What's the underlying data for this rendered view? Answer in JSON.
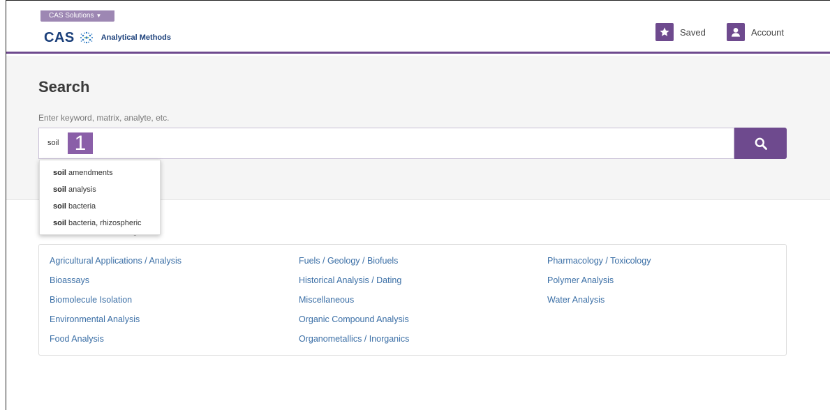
{
  "header": {
    "solutions_label": "CAS Solutions",
    "logo_text": "CAS",
    "product_name": "Analytical Methods",
    "saved_label": "Saved",
    "account_label": "Account"
  },
  "search": {
    "title": "Search",
    "hint": "Enter keyword, matrix, analyte, etc.",
    "value": "soil",
    "step_badge": "1"
  },
  "autocomplete": [
    {
      "match": "soil",
      "rest": " amendments"
    },
    {
      "match": "soil",
      "rest": " analysis"
    },
    {
      "match": "soil",
      "rest": " bacteria"
    },
    {
      "match": "soil",
      "rest": " bacteria, rhizospheric"
    }
  ],
  "browse": {
    "heading_visible_fragment": "g",
    "columns": [
      [
        "Agricultural Applications / Analysis",
        "Bioassays",
        "Biomolecule Isolation",
        "Environmental Analysis",
        "Food Analysis"
      ],
      [
        "Fuels / Geology / Biofuels",
        "Historical Analysis / Dating",
        "Miscellaneous",
        "Organic Compound Analysis",
        "Organometallics / Inorganics"
      ],
      [
        "Pharmacology / Toxicology",
        "Polymer Analysis",
        "Water Analysis"
      ]
    ]
  },
  "colors": {
    "accent": "#6e4a8e",
    "link": "#3b6fa6",
    "badge": "#8a5fa8",
    "logo": "#1a3f7a"
  },
  "icons": {
    "saved": "star-icon",
    "account": "user-icon",
    "search": "search-icon",
    "solutions": "caret-down-icon"
  }
}
